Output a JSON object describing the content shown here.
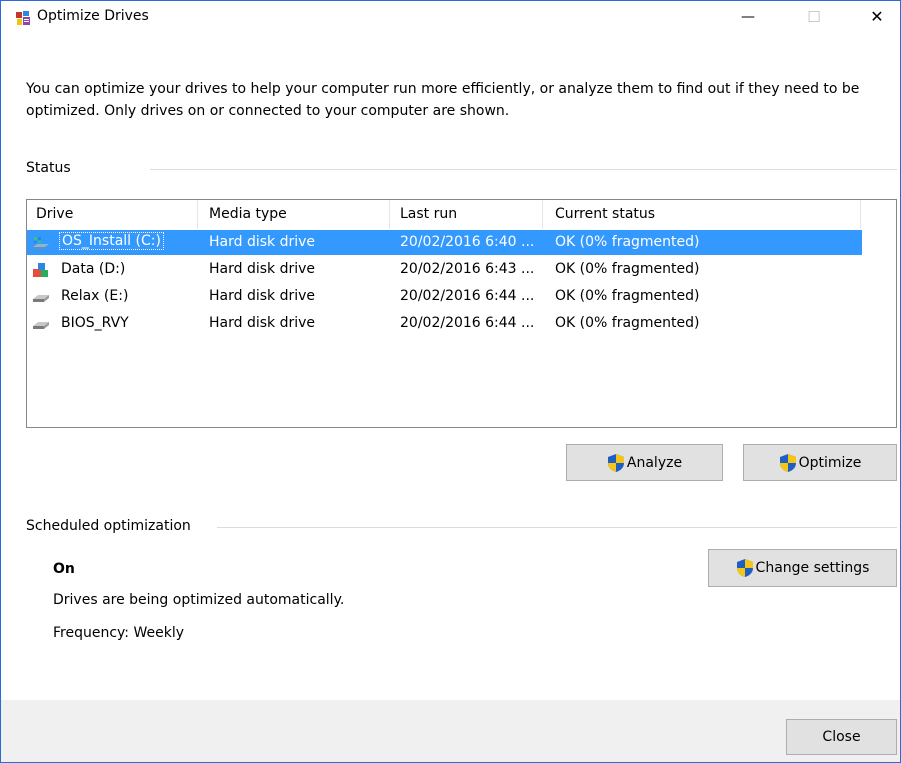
{
  "window": {
    "title": "Optimize Drives",
    "controls": {
      "minimize": "—",
      "maximize": "☐",
      "close": "✕"
    }
  },
  "intro_text": "You can optimize your drives to help your computer run more efficiently, or analyze them to find out if they need to be optimized. Only drives on or connected to your computer are shown.",
  "status": {
    "label": "Status",
    "columns": [
      "Drive",
      "Media type",
      "Last run",
      "Current status"
    ],
    "drives": [
      {
        "name": "OS_Install (C:)",
        "media_type": "Hard disk drive",
        "last_run": "20/02/2016 6:40 ...",
        "status": "OK (0% fragmented)",
        "icon": "windows-drive-icon",
        "selected": true
      },
      {
        "name": "Data (D:)",
        "media_type": "Hard disk drive",
        "last_run": "20/02/2016 6:43 ...",
        "status": "OK (0% fragmented)",
        "icon": "data-drive-icon",
        "selected": false
      },
      {
        "name": "Relax (E:)",
        "media_type": "Hard disk drive",
        "last_run": "20/02/2016 6:44 ...",
        "status": "OK (0% fragmented)",
        "icon": "hard-drive-icon",
        "selected": false
      },
      {
        "name": "BIOS_RVY",
        "media_type": "Hard disk drive",
        "last_run": "20/02/2016 6:44 ...",
        "status": "OK (0% fragmented)",
        "icon": "hard-drive-icon",
        "selected": false
      }
    ],
    "buttons": {
      "analyze": "Analyze",
      "optimize": "Optimize"
    }
  },
  "scheduled": {
    "label": "Scheduled optimization",
    "state": "On",
    "description": "Drives are being optimized automatically.",
    "frequency": "Frequency: Weekly",
    "change_settings": "Change settings"
  },
  "footer": {
    "close": "Close"
  },
  "colors": {
    "selection": "#3399ff",
    "window_border": "#2b6bd8",
    "button_face": "#e1e1e1",
    "footer_bg": "#f0f0f0"
  }
}
